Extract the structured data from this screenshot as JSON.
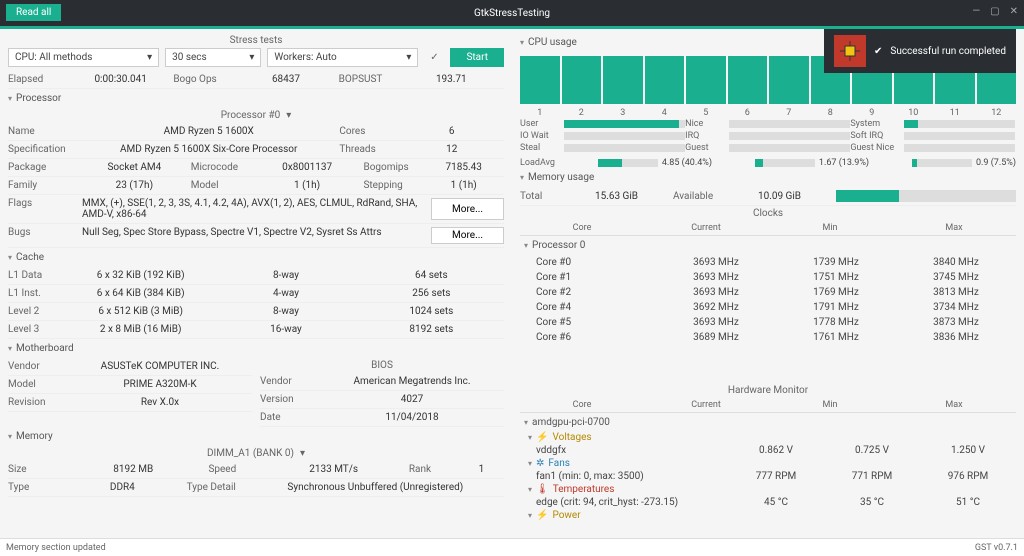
{
  "window": {
    "title": "GtkStressTesting",
    "read_all": "Read all"
  },
  "toast": {
    "text": "Successful run completed",
    "check": "✔"
  },
  "stress": {
    "header": "Stress tests",
    "cpu_methods": "CPU: All methods",
    "duration": "30 secs",
    "workers": "Workers: Auto",
    "start": "Start",
    "elapsed_lbl": "Elapsed",
    "elapsed_val": "0:00:30.041",
    "bogo_lbl": "Bogo Ops",
    "bogo_val": "68437",
    "rate_lbl": "BOPSUST",
    "rate_val": "193.71"
  },
  "processor": {
    "title": "Processor",
    "selector": "Processor #0",
    "name_lbl": "Name",
    "name_val": "AMD Ryzen 5 1600X",
    "cores_lbl": "Cores",
    "cores_val": "6",
    "spec_lbl": "Specification",
    "spec_val": "AMD Ryzen 5 1600X Six-Core Processor",
    "threads_lbl": "Threads",
    "threads_val": "12",
    "pkg_lbl": "Package",
    "pkg_val": "Socket AM4",
    "ucode_lbl": "Microcode",
    "ucode_val": "0x8001137",
    "bogomips_lbl": "Bogomips",
    "bogomips_val": "7185.43",
    "family_lbl": "Family",
    "family_val": "23 (17h)",
    "model_lbl": "Model",
    "model_val": "1 (1h)",
    "step_lbl": "Stepping",
    "step_val": "1 (1h)",
    "flags_lbl": "Flags",
    "flags_val": "MMX, (+), SSE(1, 2, 3, 3S, 4.1, 4.2, 4A), AVX(1, 2), AES, CLMUL, RdRand, SHA, AMD-V, x86-64",
    "bugs_lbl": "Bugs",
    "bugs_val": "Null Seg, Spec Store Bypass, Spectre V1, Spectre V2, Sysret Ss Attrs",
    "more": "More..."
  },
  "cache": {
    "title": "Cache",
    "rows": [
      {
        "lbl": "L1 Data",
        "size": "6 x 32 KiB (192 KiB)",
        "way": "8-way",
        "sets": "64 sets"
      },
      {
        "lbl": "L1 Inst.",
        "size": "6 x 64 KiB (384 KiB)",
        "way": "4-way",
        "sets": "256 sets"
      },
      {
        "lbl": "Level 2",
        "size": "6 x 512 KiB (3 MiB)",
        "way": "8-way",
        "sets": "1024 sets"
      },
      {
        "lbl": "Level 3",
        "size": "2 x 8 MiB (16 MiB)",
        "way": "16-way",
        "sets": "8192 sets"
      }
    ]
  },
  "mobo": {
    "title": "Motherboard",
    "bios_title": "BIOS",
    "vendor_lbl": "Vendor",
    "vendor_val": "ASUSTeK COMPUTER INC.",
    "model_lbl": "Model",
    "model_val": "PRIME A320M-K",
    "rev_lbl": "Revision",
    "rev_val": "Rev X.0x",
    "bios_vendor_lbl": "Vendor",
    "bios_vendor_val": "American Megatrends Inc.",
    "bios_ver_lbl": "Version",
    "bios_ver_val": "4027",
    "bios_date_lbl": "Date",
    "bios_date_val": "11/04/2018"
  },
  "memory": {
    "title": "Memory",
    "bank": "DIMM_A1 (BANK 0)",
    "size_lbl": "Size",
    "size_val": "8192 MB",
    "speed_lbl": "Speed",
    "speed_val": "2133 MT/s",
    "rank_lbl": "Rank",
    "rank_val": "1",
    "type_lbl": "Type",
    "type_val": "DDR4",
    "detail_lbl": "Type Detail",
    "detail_val": "Synchronous Unbuffered (Unregistered)"
  },
  "cpu_usage": {
    "title": "CPU usage",
    "cores": [
      "1",
      "2",
      "3",
      "4",
      "5",
      "6",
      "7",
      "8",
      "9",
      "10",
      "11",
      "12"
    ],
    "metrics": {
      "user": "User",
      "nice": "Nice",
      "system": "System",
      "iowait": "IO Wait",
      "irq": "IRQ",
      "softirq": "Soft IRQ",
      "steal": "Steal",
      "guest": "Guest",
      "guestnice": "Guest Nice"
    },
    "loadavg_lbl": "LoadAvg",
    "la1": "4.85 (40.4%)",
    "la5": "1.67 (13.9%)",
    "la15": "0.9 (7.5%)"
  },
  "mem_usage": {
    "title": "Memory usage",
    "total_lbl": "Total",
    "total_val": "15.63 GiB",
    "avail_lbl": "Available",
    "avail_val": "10.09 GiB"
  },
  "clocks": {
    "title": "Clocks",
    "hdr_core": "Core",
    "hdr_cur": "Current",
    "hdr_min": "Min",
    "hdr_max": "Max",
    "proc": "Processor 0",
    "rows": [
      {
        "name": "Core #0",
        "cur": "3693 MHz",
        "min": "1739 MHz",
        "max": "3840 MHz"
      },
      {
        "name": "Core #1",
        "cur": "3693 MHz",
        "min": "1751 MHz",
        "max": "3745 MHz"
      },
      {
        "name": "Core #2",
        "cur": "3693 MHz",
        "min": "1769 MHz",
        "max": "3813 MHz"
      },
      {
        "name": "Core #4",
        "cur": "3692 MHz",
        "min": "1791 MHz",
        "max": "3734 MHz"
      },
      {
        "name": "Core #5",
        "cur": "3693 MHz",
        "min": "1778 MHz",
        "max": "3873 MHz"
      },
      {
        "name": "Core #6",
        "cur": "3689 MHz",
        "min": "1761 MHz",
        "max": "3836 MHz"
      }
    ]
  },
  "hw": {
    "title": "Hardware Monitor",
    "hdr_core": "Core",
    "hdr_cur": "Current",
    "hdr_min": "Min",
    "hdr_max": "Max",
    "device": "amdgpu-pci-0700",
    "voltages": "Voltages",
    "fans": "Fans",
    "temps": "Temperatures",
    "power": "Power",
    "vddgfx": {
      "name": "vddgfx",
      "cur": "0.862 V",
      "min": "0.725 V",
      "max": "1.250 V"
    },
    "fan1": {
      "name": "fan1 (min: 0, max: 3500)",
      "cur": "777 RPM",
      "min": "771 RPM",
      "max": "976 RPM"
    },
    "edge": {
      "name": "edge (crit: 94, crit_hyst: -273.15)",
      "cur": "45 °C",
      "min": "35 °C",
      "max": "51 °C"
    }
  },
  "status": {
    "left": "Memory section updated",
    "right": "GST v0.7.1"
  },
  "chart_data": {
    "type": "bar",
    "title": "CPU usage per core",
    "categories": [
      "1",
      "2",
      "3",
      "4",
      "5",
      "6",
      "7",
      "8",
      "9",
      "10",
      "11",
      "12"
    ],
    "values": [
      100,
      100,
      100,
      100,
      100,
      100,
      100,
      100,
      100,
      100,
      100,
      100
    ],
    "ylim": [
      0,
      100
    ],
    "metrics": {
      "User": 95,
      "Nice": 0,
      "System": 12,
      "IO Wait": 0,
      "IRQ": 0,
      "Soft IRQ": 0,
      "Steal": 0,
      "Guest": 0,
      "Guest Nice": 0
    },
    "loadavg": [
      4.85,
      1.67,
      0.9
    ],
    "memory": {
      "total_gib": 15.63,
      "available_gib": 10.09,
      "used_pct": 35
    }
  }
}
